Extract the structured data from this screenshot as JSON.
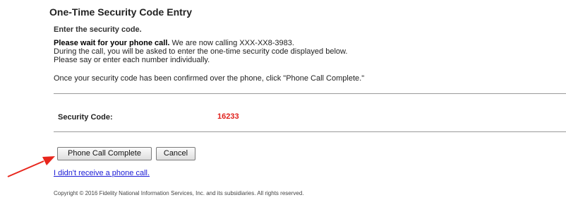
{
  "page": {
    "title": "One-Time Security Code Entry",
    "subtitle": "Enter the security code."
  },
  "instructions": {
    "wait_bold": "Please wait for your phone call.",
    "calling_text": " We are now calling XXX-XX8-3983.",
    "line2": "During the call, you will be asked to enter the one-time security code displayed below.",
    "line3": "Please say or enter each number individually.",
    "confirm_note": "Once your security code has been confirmed over the phone, click \"Phone Call Complete.\""
  },
  "security_code": {
    "label": "Security Code:",
    "value": "16233",
    "value_color": "#e0201b"
  },
  "actions": {
    "complete_label": "Phone Call Complete",
    "cancel_label": "Cancel",
    "no_call_link": "I didn't receive a phone call."
  },
  "footer": {
    "copyright": "Copyright © 2016 Fidelity National Information Services, Inc. and its subsidiaries. All rights reserved."
  },
  "annotation": {
    "color": "#e8261c",
    "icon": "red-arrow-icon"
  }
}
